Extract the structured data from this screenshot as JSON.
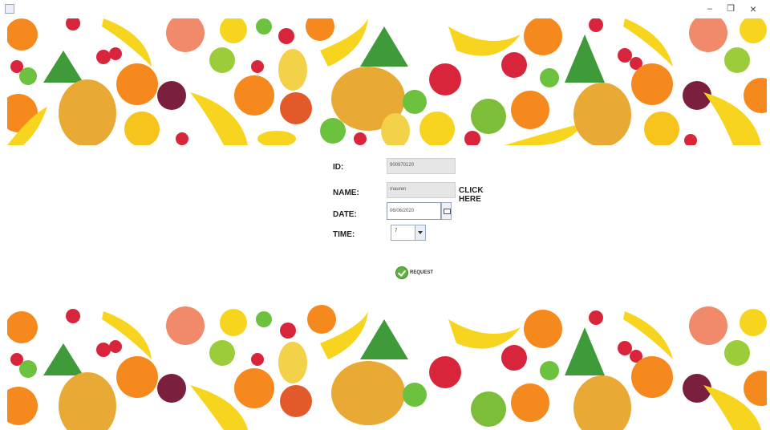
{
  "window": {
    "minimize_glyph": "–",
    "maximize_glyph": "❐",
    "close_glyph": "×"
  },
  "form": {
    "id_label": "ID:",
    "id_value": "900970120",
    "name_label": "NAME:",
    "name_value": "mauren",
    "click_here_label": "CLICK HERE",
    "date_label": "DATE:",
    "date_value": "06/06/2020",
    "time_label": "TIME:",
    "time_value": "7",
    "request_label": "REQUEST"
  },
  "icons": {
    "app": "app-icon",
    "calendar": "calendar-icon",
    "dropdown": "chevron-down-icon",
    "request": "check-icon"
  },
  "colors": {
    "orange": "#f5891d",
    "banana": "#f7d51e",
    "pineapple": "#e8a935",
    "leaf": "#3f9a3a",
    "apple_red": "#d9253b",
    "grape": "#7a1f3d",
    "lime": "#6cc13e",
    "check": "#5db33b"
  }
}
